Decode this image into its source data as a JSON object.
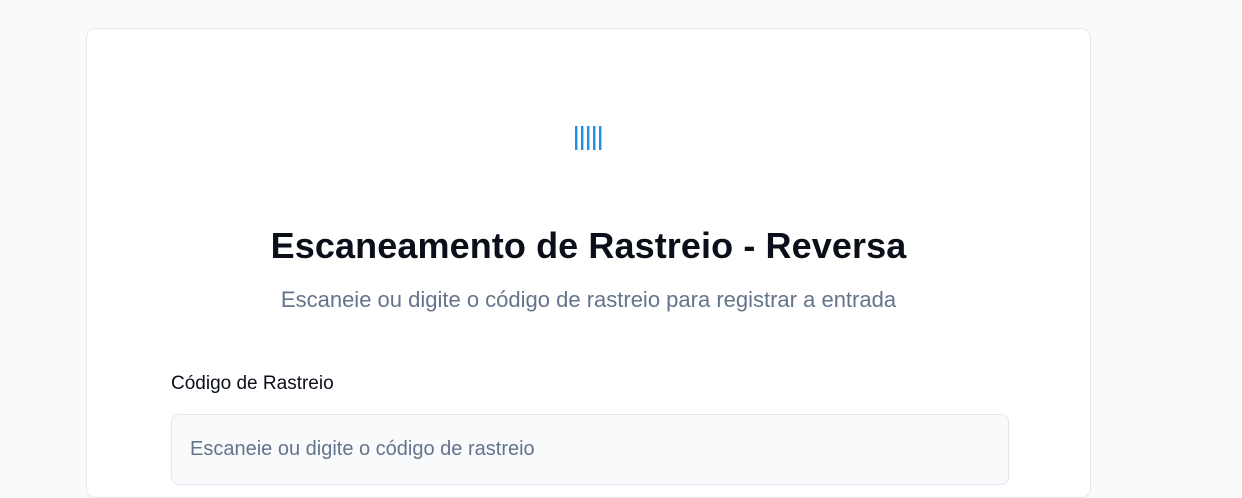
{
  "scan": {
    "icon": "barcode-icon",
    "accent_color": "#1d8fe6",
    "title": "Escaneamento de Rastreio - Reversa",
    "subtitle": "Escaneie ou digite o código de rastreio para registrar a entrada",
    "field_label": "Código de Rastreio",
    "input_value": "",
    "input_placeholder": "Escaneie ou digite o código de rastreio"
  }
}
